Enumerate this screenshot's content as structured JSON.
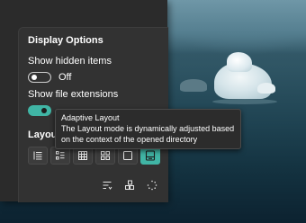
{
  "options_panel": {
    "title": "Display Options",
    "show_hidden_items": {
      "label": "Show hidden items",
      "state": "Off",
      "enabled": false
    },
    "show_file_extensions": {
      "label": "Show file extensions",
      "state": "On",
      "enabled": true
    },
    "layout_heading": "Layout",
    "layout_buttons": [
      {
        "icon": "details-view-icon"
      },
      {
        "icon": "list-view-icon"
      },
      {
        "icon": "grid-small-icon"
      },
      {
        "icon": "grid-medium-icon"
      },
      {
        "icon": "grid-large-icon"
      },
      {
        "icon": "adaptive-layout-icon",
        "selected": true
      }
    ],
    "footer_buttons": [
      {
        "icon": "sort-icon"
      },
      {
        "icon": "group-icon"
      },
      {
        "icon": "loading-spinner-icon"
      }
    ]
  },
  "tooltip": {
    "title": "Adaptive Layout",
    "line1": "The Layout mode is dynamically adjusted based",
    "line2": "on the context of the opened directory"
  },
  "colors": {
    "accent": "#40b5a5",
    "panel_bg": "#2b2b2b",
    "panel_inner_bg": "#323232",
    "text": "#ffffff"
  }
}
